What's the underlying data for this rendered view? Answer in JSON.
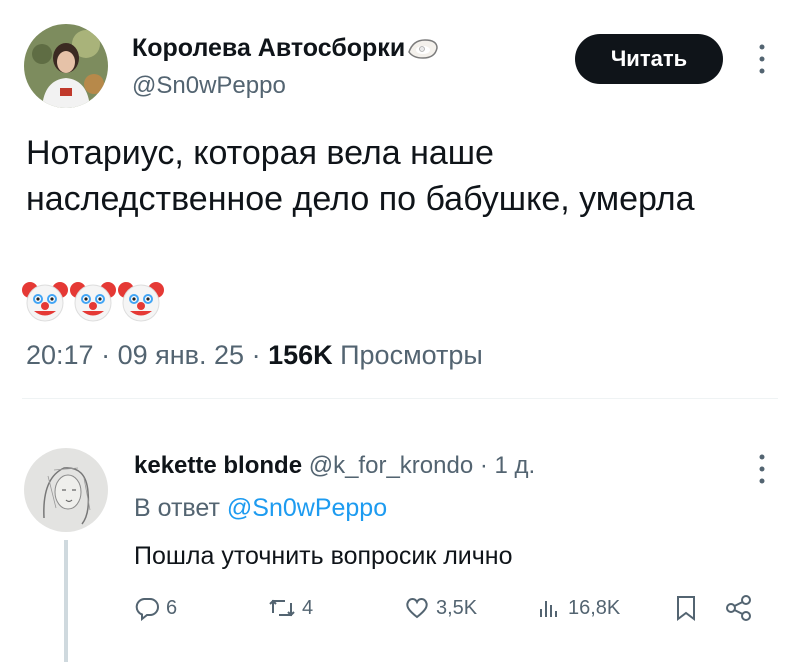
{
  "tweet": {
    "author_name": "Королева Автосборки",
    "author_handle": "@Sn0wPeppo",
    "follow_label": "Читать",
    "text": "Нотариус, которая вела наше\nнаследственное дело по бабушке, умерла",
    "emoji": [
      "🤡",
      "🤡",
      "🤡"
    ],
    "time": "20:17",
    "date": "09 янв. 25",
    "views_count": "156K",
    "views_label": "Просмотры"
  },
  "reply": {
    "author_name": "kekette blonde",
    "author_handle": "@k_for_krondo",
    "age": "1 д.",
    "reply_prefix": "В ответ",
    "reply_to": "@Sn0wPeppo",
    "text": "Пошла уточнить вопросик лично",
    "replies": "6",
    "retweets": "4",
    "likes": "3,5K",
    "views": "16,8K"
  },
  "icons": [
    "oyster-emoji-icon",
    "more-icon",
    "reply-icon",
    "retweet-icon",
    "like-icon",
    "views-icon",
    "bookmark-icon",
    "share-icon"
  ]
}
